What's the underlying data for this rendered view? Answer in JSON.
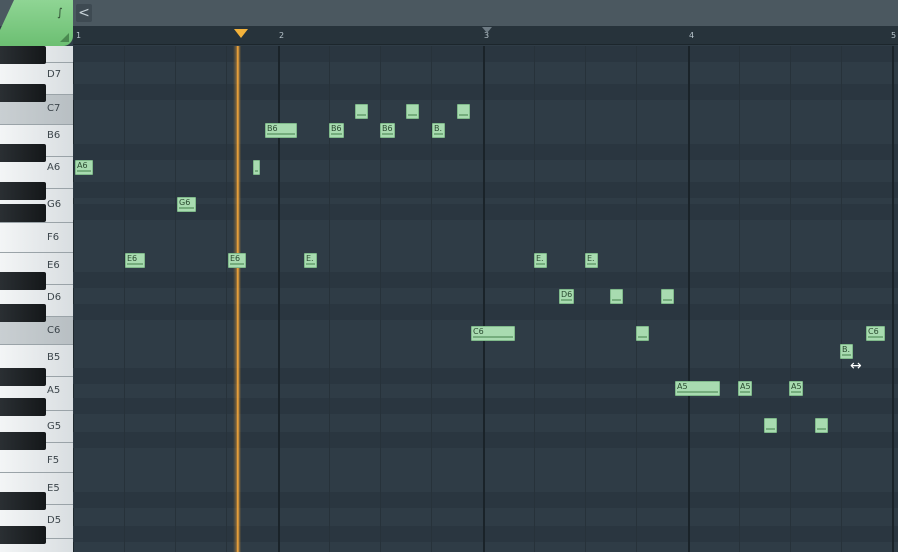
{
  "toolbar": {
    "back_icon": "chevron-left-icon",
    "back_label": "<"
  },
  "ruler": {
    "bars": [
      "1",
      "2",
      "3",
      "4",
      "5"
    ]
  },
  "keyboard": {
    "labels": [
      "D7",
      "C7",
      "B6",
      "A6",
      "G6",
      "F6",
      "E6",
      "D6",
      "C6",
      "B5",
      "A5",
      "G5",
      "F5",
      "E5",
      "D5"
    ]
  },
  "notes": [
    {
      "label": "A6"
    },
    {
      "label": "E6"
    },
    {
      "label": "G6"
    },
    {
      "label": "E6"
    },
    {
      "label": ""
    },
    {
      "label": "B6"
    },
    {
      "label": "E."
    },
    {
      "label": "B6"
    },
    {
      "label": ""
    },
    {
      "label": "B6"
    },
    {
      "label": ""
    },
    {
      "label": "B."
    },
    {
      "label": ""
    },
    {
      "label": "C6"
    },
    {
      "label": "E."
    },
    {
      "label": "D6"
    },
    {
      "label": "E."
    },
    {
      "label": ""
    },
    {
      "label": ""
    },
    {
      "label": ""
    },
    {
      "label": "A5"
    },
    {
      "label": "A5"
    },
    {
      "label": ""
    },
    {
      "label": "A5"
    },
    {
      "label": ""
    },
    {
      "label": "B."
    },
    {
      "label": "C6"
    }
  ],
  "colors": {
    "note_fill": "#a8dbb0",
    "playhead": "#ffad3a",
    "accent": "#7ccc82"
  }
}
